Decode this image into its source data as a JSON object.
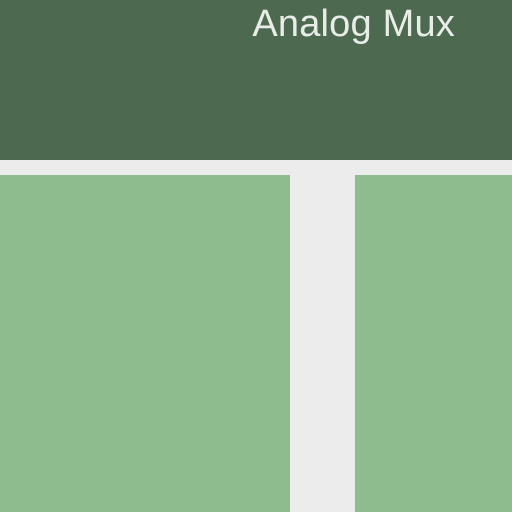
{
  "header": {
    "title": "Analog Mux"
  },
  "colors": {
    "header_bg": "#4D6A50",
    "header_text": "#E8EDE8",
    "page_bg": "#ECECEC",
    "panel_bg": "#8EBC8E"
  }
}
